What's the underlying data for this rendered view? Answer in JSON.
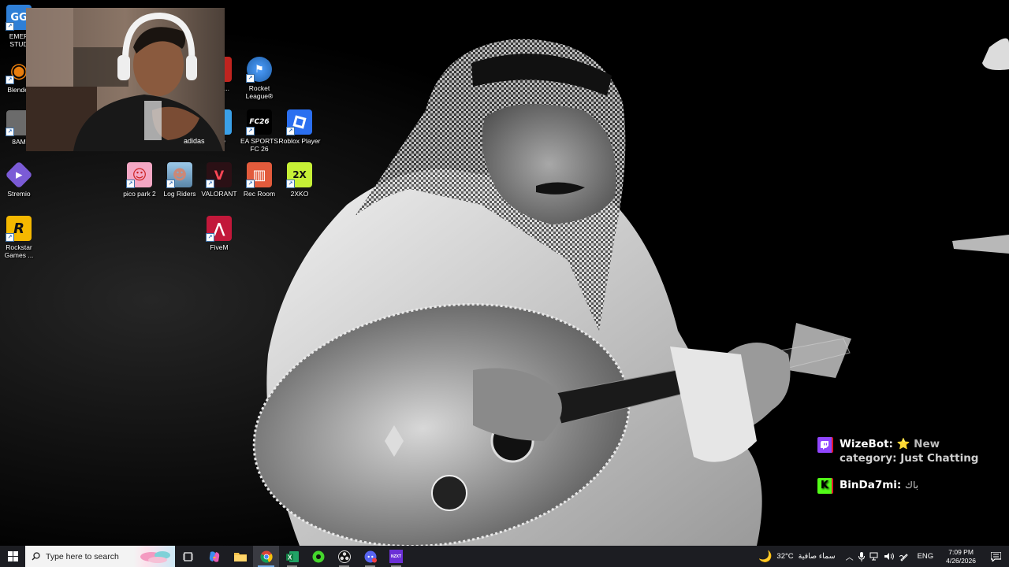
{
  "desktop_icons": [
    {
      "id": "emerald",
      "label": "EMER\nSTUD",
      "color": "#2f7fd6",
      "glyph": "GG"
    },
    {
      "id": "blender",
      "label": "Blender",
      "color": "#e87d0d",
      "glyph": "◉"
    },
    {
      "id": "8am",
      "label": "8AM",
      "color": "#6b6b6b",
      "glyph": ""
    },
    {
      "id": "stremio",
      "label": "Stremio",
      "color": "#7b5bd6",
      "glyph": "▶"
    },
    {
      "id": "rockstar",
      "label": "Rockstar\nGames ...",
      "color": "#f5b800",
      "glyph": "R"
    },
    {
      "id": "fallguys",
      "label": "...ght...",
      "color": "#c0241f",
      "glyph": ""
    },
    {
      "id": "fortnite",
      "label": "...ite",
      "color": "#3aa0e8",
      "glyph": ""
    },
    {
      "id": "rocket-league",
      "label": "Rocket\nLeague®",
      "color": "#1f5fa8",
      "glyph": "⚑"
    },
    {
      "id": "ea-fc",
      "label": "EA SPORTS\nFC 26",
      "color": "#000000",
      "glyph": "FC26"
    },
    {
      "id": "roblox",
      "label": "Roblox Player",
      "color": "#2b6ff0",
      "glyph": "■"
    },
    {
      "id": "pico-park",
      "label": "pico park 2",
      "color": "#f4a7c4",
      "glyph": "☺"
    },
    {
      "id": "log-riders",
      "label": "Log Riders",
      "color": "#6fa3c8",
      "glyph": "☻"
    },
    {
      "id": "valorant",
      "label": "VALORANT",
      "color": "#2b1015",
      "glyph": "V"
    },
    {
      "id": "rec-room",
      "label": "Rec Room",
      "color": "#e25b3c",
      "glyph": "▥"
    },
    {
      "id": "2xko",
      "label": "2XKO",
      "color": "#c6f036",
      "glyph": "2X"
    },
    {
      "id": "fivem",
      "label": "FiveM",
      "color": "#c2183a",
      "glyph": "⋀"
    }
  ],
  "chat": [
    {
      "user": "WizeBot:",
      "emoji": "⭐",
      "text": "New",
      "text2": "category: Just Chatting",
      "badge_color": "#9146ff",
      "badge": "twitch"
    },
    {
      "user": "BinDa7mi:",
      "text": "باك",
      "badge_color": "#53fc18",
      "badge": "kick"
    }
  ],
  "taskbar": {
    "search_placeholder": "Type here to search",
    "apps": [
      "task-view",
      "copilot",
      "file-explorer",
      "chrome",
      "excel",
      "razer",
      "obs",
      "discord",
      "nzxt"
    ],
    "nzxt_label": "NZXT",
    "weather_temp": "32°C",
    "weather_text": "سماء صافية",
    "language": "ENG",
    "time": "7:09 PM",
    "date": "4/26/2026"
  },
  "colors": {
    "taskbar": "#1c1d22",
    "twitch": "#9146ff",
    "kick": "#53fc18",
    "accent": "#77aee8"
  }
}
